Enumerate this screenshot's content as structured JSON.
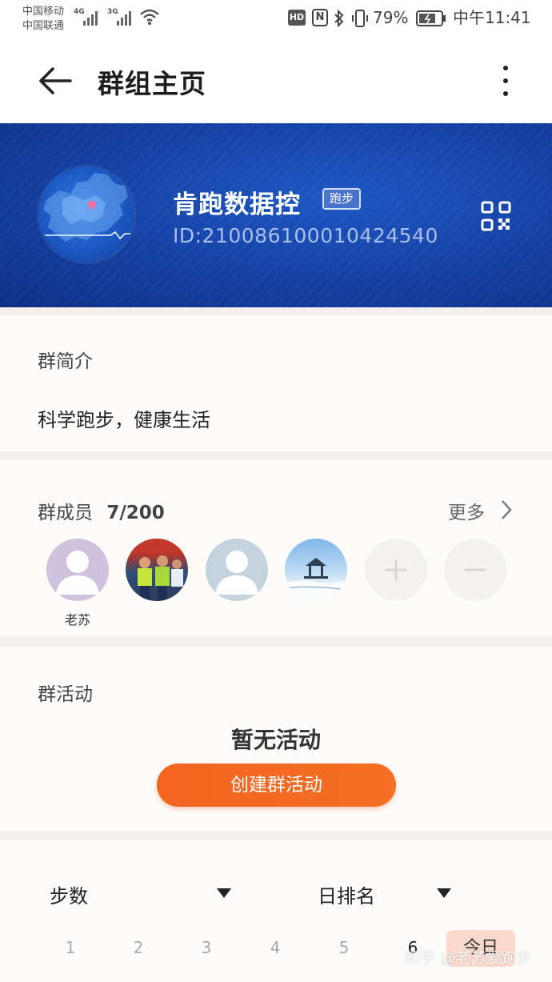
{
  "status_bar": {
    "carrier_1": "中国移动",
    "carrier_2": "中国联通",
    "network_1": "4G",
    "network_2": "3G",
    "hd_label": "HD",
    "nfc_label": "N",
    "battery_percent": "79%",
    "time": "中午11:41"
  },
  "header": {
    "title": "群组主页"
  },
  "group": {
    "name": "肯跑数据控",
    "tag": "跑步",
    "id": "ID:210086100010424540"
  },
  "intro": {
    "title": "群简介",
    "text": "科学跑步，健康生活"
  },
  "members": {
    "title": "群成员",
    "count": "7/200",
    "more_label": "更多",
    "list": [
      {
        "name": "老苏",
        "avatar": "default-purple"
      },
      {
        "name": "",
        "avatar": "photo-runners"
      },
      {
        "name": "",
        "avatar": "default-gray"
      },
      {
        "name": "",
        "avatar": "photo-pavilion"
      }
    ],
    "add_icon": "+",
    "remove_icon": "−"
  },
  "activity": {
    "title": "群活动",
    "empty_text": "暂无活动",
    "create_button": "创建群活动"
  },
  "ranking": {
    "metric_label": "步数",
    "period_label": "日排名",
    "days": [
      "1",
      "2",
      "3",
      "4",
      "5",
      "6"
    ],
    "today_label": "今日"
  },
  "watermark": "知乎 @老苏爱跑步",
  "colors": {
    "banner_blue": "#1644a8",
    "accent_orange": "#f3641f",
    "today_chip": "#fbd9cc"
  }
}
